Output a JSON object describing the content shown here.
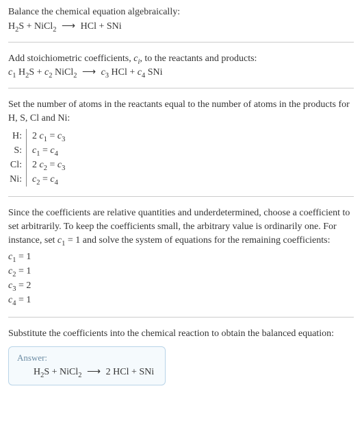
{
  "section1": {
    "heading": "Balance the chemical equation algebraically:",
    "equation_html": "H<span class='sub'>2</span>S + NiCl<span class='sub'>2</span> <span class='arrow'>⟶</span> HCl + SNi"
  },
  "section2": {
    "heading_html": "Add stoichiometric coefficients, <span class='italic'>c<span class='sub'>i</span></span>, to the reactants and products:",
    "equation_html": "<span class='italic'>c</span><span class='sub'>1</span> H<span class='sub'>2</span>S + <span class='italic'>c</span><span class='sub'>2</span> NiCl<span class='sub'>2</span> <span class='arrow'>⟶</span> <span class='italic'>c</span><span class='sub'>3</span> HCl + <span class='italic'>c</span><span class='sub'>4</span> SNi"
  },
  "section3": {
    "heading": "Set the number of atoms in the reactants equal to the number of atoms in the products for H, S, Cl and Ni:",
    "rows": [
      {
        "label": "H:",
        "eq_html": "2 <span class='italic'>c</span><span class='sub'>1</span> = <span class='italic'>c</span><span class='sub'>3</span>"
      },
      {
        "label": "S:",
        "eq_html": "<span class='italic'>c</span><span class='sub'>1</span> = <span class='italic'>c</span><span class='sub'>4</span>"
      },
      {
        "label": "Cl:",
        "eq_html": "2 <span class='italic'>c</span><span class='sub'>2</span> = <span class='italic'>c</span><span class='sub'>3</span>"
      },
      {
        "label": "Ni:",
        "eq_html": "<span class='italic'>c</span><span class='sub'>2</span> = <span class='italic'>c</span><span class='sub'>4</span>"
      }
    ]
  },
  "section4": {
    "heading_html": "Since the coefficients are relative quantities and underdetermined, choose a coefficient to set arbitrarily. To keep the coefficients small, the arbitrary value is ordinarily one. For instance, set <span class='italic'>c</span><span class='sub'>1</span> = 1 and solve the system of equations for the remaining coefficients:",
    "coefs": [
      {
        "html": "<span class='italic'>c</span><span class='sub'>1</span> = 1"
      },
      {
        "html": "<span class='italic'>c</span><span class='sub'>2</span> = 1"
      },
      {
        "html": "<span class='italic'>c</span><span class='sub'>3</span> = 2"
      },
      {
        "html": "<span class='italic'>c</span><span class='sub'>4</span> = 1"
      }
    ]
  },
  "section5": {
    "heading": "Substitute the coefficients into the chemical reaction to obtain the balanced equation:",
    "answer_label": "Answer:",
    "answer_html": "H<span class='sub'>2</span>S + NiCl<span class='sub'>2</span> <span class='arrow'>⟶</span> 2 HCl + SNi"
  },
  "chart_data": {
    "type": "table",
    "title": "Atom balance equations",
    "rows": [
      {
        "element": "H",
        "equation": "2 c1 = c3"
      },
      {
        "element": "S",
        "equation": "c1 = c4"
      },
      {
        "element": "Cl",
        "equation": "2 c2 = c3"
      },
      {
        "element": "Ni",
        "equation": "c2 = c4"
      }
    ],
    "solution": {
      "c1": 1,
      "c2": 1,
      "c3": 2,
      "c4": 1
    },
    "balanced_equation": "H2S + NiCl2 ⟶ 2 HCl + SNi"
  }
}
